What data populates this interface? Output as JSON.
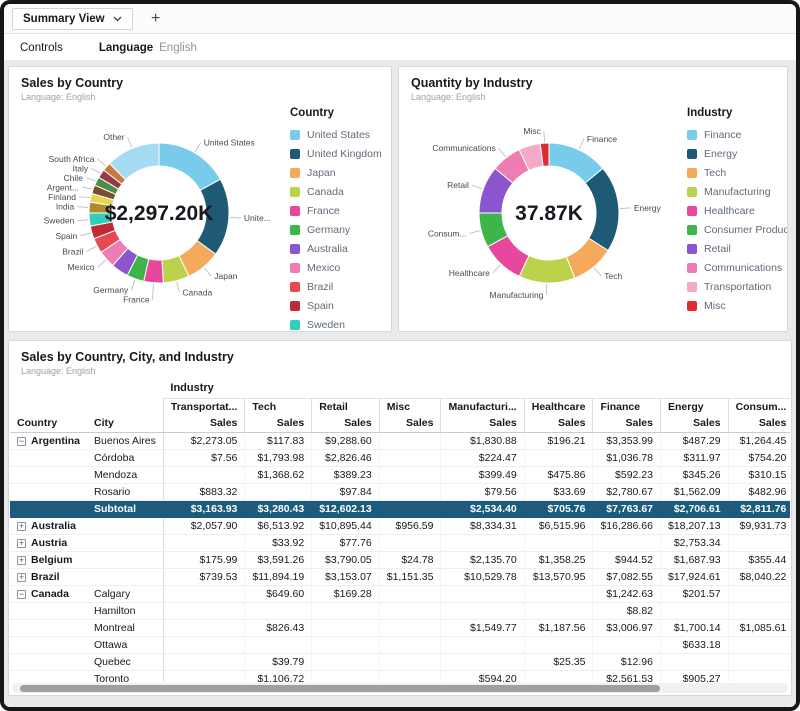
{
  "tabs": [
    {
      "label": "Summary View"
    }
  ],
  "add_tab_label": "+",
  "controls": {
    "title": "Controls",
    "language_label": "Language",
    "language_value": "English"
  },
  "chart_data": [
    {
      "type": "donut",
      "title": "Sales by Country",
      "subtitle": "Language: English",
      "center_label": "$2,297.20K",
      "legend_title": "Country",
      "value_unit": "estimated_percent_share",
      "slices": [
        {
          "name": "United States",
          "label": "United States",
          "value": 17,
          "color": "#79CBEC",
          "legend": true
        },
        {
          "name": "United Kingdom",
          "label": "Unite...",
          "value": 18,
          "color": "#1F5A75",
          "legend": true
        },
        {
          "name": "Japan",
          "label": "Japan",
          "value": 8,
          "color": "#F5A95B",
          "legend": true
        },
        {
          "name": "Canada",
          "label": "Canada",
          "value": 6,
          "color": "#BCD24D",
          "legend": true
        },
        {
          "name": "France",
          "label": "France",
          "value": 4.5,
          "color": "#E7489D",
          "legend": true
        },
        {
          "name": "Germany",
          "label": "Germany",
          "value": 4,
          "color": "#3DB54B",
          "legend": true
        },
        {
          "name": "Australia",
          "label": "",
          "value": 4,
          "color": "#8A55CE",
          "legend": true
        },
        {
          "name": "Mexico",
          "label": "Mexico",
          "value": 4,
          "color": "#F07CB4",
          "legend": true
        },
        {
          "name": "Brazil",
          "label": "Brazil",
          "value": 3.5,
          "color": "#E8484F",
          "legend": true
        },
        {
          "name": "Spain",
          "label": "Spain",
          "value": 3,
          "color": "#C02A34",
          "legend": true
        },
        {
          "name": "Sweden",
          "label": "Sweden",
          "value": 3,
          "color": "#30CFBB",
          "legend": true
        },
        {
          "name": "India",
          "label": "India",
          "value": 2.5,
          "color": "#B08A2E",
          "legend": false
        },
        {
          "name": "Finland",
          "label": "Finland",
          "value": 2,
          "color": "#E8D44D",
          "legend": false
        },
        {
          "name": "Argentina",
          "label": "Argent...",
          "value": 2,
          "color": "#7A4E2D",
          "legend": false
        },
        {
          "name": "Chile",
          "label": "Chile",
          "value": 2,
          "color": "#4D8E44",
          "legend": false
        },
        {
          "name": "Italy",
          "label": "Italy",
          "value": 2,
          "color": "#943A4A",
          "legend": false
        },
        {
          "name": "South Africa",
          "label": "South Africa",
          "value": 2,
          "color": "#C77A3A",
          "legend": false
        },
        {
          "name": "Other",
          "label": "Other",
          "value": 12.5,
          "color": "#A5DBF2",
          "legend": false
        }
      ]
    },
    {
      "type": "donut",
      "title": "Quantity by Industry",
      "subtitle": "Language: English",
      "center_label": "37.87K",
      "legend_title": "Industry",
      "value_unit": "estimated_percent_share",
      "slices": [
        {
          "name": "Finance",
          "label": "Finance",
          "value": 14,
          "color": "#79CBEC",
          "legend": true
        },
        {
          "name": "Energy",
          "label": "Energy",
          "value": 20,
          "color": "#1F5A75",
          "legend": true
        },
        {
          "name": "Tech",
          "label": "Tech",
          "value": 10,
          "color": "#F5A95B",
          "legend": true
        },
        {
          "name": "Manufacturing",
          "label": "Manufacturing",
          "value": 13,
          "color": "#BCD24D",
          "legend": true
        },
        {
          "name": "Healthcare",
          "label": "Healthcare",
          "value": 10,
          "color": "#E7489D",
          "legend": true
        },
        {
          "name": "Consumer Products",
          "label": "Consum...",
          "value": 8,
          "color": "#3DB54B",
          "legend": true
        },
        {
          "name": "Retail",
          "label": "Retail",
          "value": 11,
          "color": "#8A55CE",
          "legend": true
        },
        {
          "name": "Communications",
          "label": "Communications",
          "value": 7,
          "color": "#F07CB4",
          "legend": true
        },
        {
          "name": "Transportation",
          "label": "",
          "value": 5,
          "color": "#F4A9C9",
          "legend": true
        },
        {
          "name": "Misc",
          "label": "Misc",
          "value": 2,
          "color": "#DF2B31",
          "legend": true
        }
      ]
    },
    {
      "type": "table",
      "title": "Sales by Country, City, and Industry",
      "subtitle": "Language: English",
      "group_header": "Industry",
      "row_headers": [
        "Country",
        "City"
      ],
      "measure_label": "Sales",
      "columns": [
        "Transportat...",
        "Tech",
        "Retail",
        "Misc",
        "Manufacturi...",
        "Healthcare",
        "Finance",
        "Energy",
        "Consum..."
      ],
      "rows": [
        {
          "country": "Argentina",
          "icon": "minus",
          "city": "Buenos Aires",
          "subtotal": false,
          "values": [
            "$2,273.05",
            "$117.83",
            "$9,288.60",
            "",
            "$1,830.88",
            "$196.21",
            "$3,353.99",
            "$487.29",
            "$1,264.45"
          ]
        },
        {
          "country": "",
          "icon": null,
          "city": "Córdoba",
          "subtotal": false,
          "values": [
            "$7.56",
            "$1,793.98",
            "$2,826.46",
            "",
            "$224.47",
            "",
            "$1,036.78",
            "$311.97",
            "$754.20"
          ]
        },
        {
          "country": "",
          "icon": null,
          "city": "Mendoza",
          "subtotal": false,
          "values": [
            "",
            "$1,368.62",
            "$389.23",
            "",
            "$399.49",
            "$475.86",
            "$592.23",
            "$345.26",
            "$310.15"
          ]
        },
        {
          "country": "",
          "icon": null,
          "city": "Rosario",
          "subtotal": false,
          "values": [
            "$883.32",
            "",
            "$97.84",
            "",
            "$79.56",
            "$33.69",
            "$2,780.67",
            "$1,562.09",
            "$482.96"
          ]
        },
        {
          "country": "",
          "icon": null,
          "city": "Subtotal",
          "subtotal": true,
          "values": [
            "$3,163.93",
            "$3,280.43",
            "$12,602.13",
            "",
            "$2,534.40",
            "$705.76",
            "$7,763.67",
            "$2,706.61",
            "$2,811.76"
          ]
        },
        {
          "country": "Australia",
          "icon": "plus",
          "city": "",
          "subtotal": false,
          "values": [
            "$2,057.90",
            "$6,513.92",
            "$10,895.44",
            "$956.59",
            "$8,334.31",
            "$6,515.96",
            "$16,286.66",
            "$18,207.13",
            "$9,931.73"
          ]
        },
        {
          "country": "Austria",
          "icon": "plus",
          "city": "",
          "subtotal": false,
          "values": [
            "",
            "$33.92",
            "$77.76",
            "",
            "",
            "",
            "",
            "$2,753.34",
            ""
          ]
        },
        {
          "country": "Belgium",
          "icon": "plus",
          "city": "",
          "subtotal": false,
          "values": [
            "$175.99",
            "$3,591.26",
            "$3,790.05",
            "$24.78",
            "$2,135.70",
            "$1,358.25",
            "$944.52",
            "$1,687.93",
            "$355.44"
          ]
        },
        {
          "country": "Brazil",
          "icon": "plus",
          "city": "",
          "subtotal": false,
          "values": [
            "$739.53",
            "$11,894.19",
            "$3,153.07",
            "$1,151.35",
            "$10,529.78",
            "$13,570.95",
            "$7,082.55",
            "$17,924.61",
            "$8,040.22"
          ]
        },
        {
          "country": "Canada",
          "icon": "minus",
          "city": "Calgary",
          "subtotal": false,
          "values": [
            "",
            "$649.60",
            "$169.28",
            "",
            "",
            "",
            "$1,242.63",
            "$201.57",
            ""
          ]
        },
        {
          "country": "",
          "icon": null,
          "city": "Hamilton",
          "subtotal": false,
          "values": [
            "",
            "",
            "",
            "",
            "",
            "",
            "$8.82",
            "",
            ""
          ]
        },
        {
          "country": "",
          "icon": null,
          "city": "Montreal",
          "subtotal": false,
          "values": [
            "",
            "$826.43",
            "",
            "",
            "$1,549.77",
            "$1,187.56",
            "$3,006.97",
            "$1,700.14",
            "$1,085.61"
          ]
        },
        {
          "country": "",
          "icon": null,
          "city": "Ottawa",
          "subtotal": false,
          "values": [
            "",
            "",
            "",
            "",
            "",
            "",
            "",
            "$633.18",
            ""
          ]
        },
        {
          "country": "",
          "icon": null,
          "city": "Quebec",
          "subtotal": false,
          "values": [
            "",
            "$39.79",
            "",
            "",
            "",
            "$25.35",
            "$12.96",
            "",
            ""
          ]
        },
        {
          "country": "",
          "icon": null,
          "city": "Toronto",
          "subtotal": false,
          "values": [
            "",
            "$1,106.72",
            "",
            "",
            "$594.20",
            "",
            "$2,561.53",
            "$905.27",
            ""
          ]
        }
      ]
    }
  ]
}
